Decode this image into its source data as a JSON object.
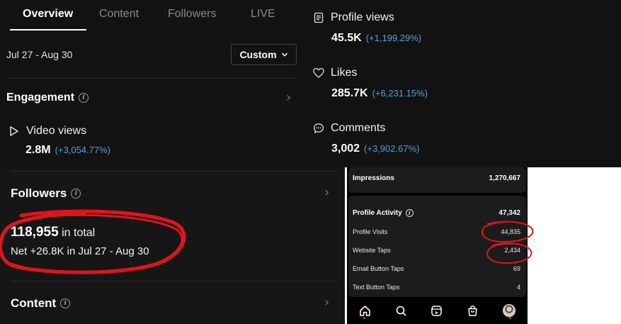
{
  "tabs": {
    "overview": "Overview",
    "content": "Content",
    "followers": "Followers",
    "live": "LIVE"
  },
  "date_range": "Jul 27 - Aug 30",
  "custom_label": "Custom",
  "engagement": {
    "title": "Engagement",
    "video_views": {
      "label": "Video views",
      "value": "2.8M",
      "change": "(+3,054.77%)"
    }
  },
  "right_metrics": {
    "profile_views": {
      "label": "Profile views",
      "value": "45.5K",
      "change": "(+1,199.29%)"
    },
    "likes": {
      "label": "Likes",
      "value": "285.7K",
      "change": "(+6,231.15%)"
    },
    "comments": {
      "label": "Comments",
      "value": "3,002",
      "change": "(+3,902.67%)"
    }
  },
  "followers": {
    "title": "Followers",
    "total_value": "118,955",
    "total_suffix": "in total",
    "net": "Net +26.8K in Jul 27 - Aug 30"
  },
  "content_section": {
    "title": "Content"
  },
  "phone": {
    "impressions": {
      "label": "Impressions",
      "value": "1,270,667"
    },
    "profile_activity": {
      "label": "Profile Activity",
      "value": "47,342"
    },
    "rows": [
      {
        "label": "Profile Visits",
        "value": "44,835"
      },
      {
        "label": "Website Taps",
        "value": "2,434"
      },
      {
        "label": "Email Button Taps",
        "value": "69"
      },
      {
        "label": "Text Button Taps",
        "value": "4"
      }
    ],
    "nav_icons": [
      "home-icon",
      "search-icon",
      "reels-icon",
      "shop-icon",
      "profile-avatar"
    ]
  },
  "colors": {
    "accent_change": "#4fa3d6",
    "annotation_red": "#e0141c"
  }
}
